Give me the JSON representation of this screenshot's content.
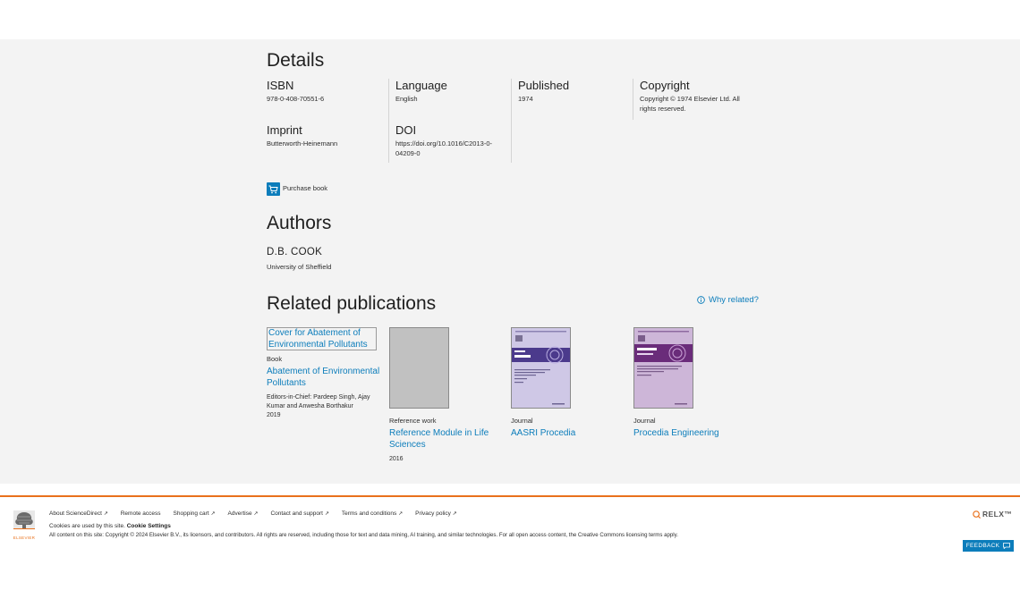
{
  "details": {
    "heading": "Details",
    "isbn_label": "ISBN",
    "isbn_value": "978-0-408-70551-6",
    "language_label": "Language",
    "language_value": "English",
    "published_label": "Published",
    "published_value": "1974",
    "copyright_label": "Copyright",
    "copyright_line1": "Copyright © 1974 Elsevier Ltd. All",
    "copyright_line2": "rights reserved.",
    "imprint_label": "Imprint",
    "imprint_value": "Butterworth-Heinemann",
    "doi_label": "DOI",
    "doi_line1": "https://doi.org/10.1016/C2013-0-",
    "doi_line2": "04209-0",
    "purchase_label": "Purchase book"
  },
  "authors": {
    "heading": "Authors",
    "name": "D.B. COOK",
    "affiliation": "University of Sheffield"
  },
  "related": {
    "heading": "Related publications",
    "why_related": "Why related?",
    "items": [
      {
        "cover_alt_line1": "Cover for Abatement of",
        "cover_alt_line2": "Environmental Pollutants",
        "type": "Book",
        "title_line1": "Abatement of Environmental",
        "title_line2": "Pollutants",
        "editors_line1": "Editors-in-Chief: Pardeep Singh, Ajay",
        "editors_line2": "Kumar and Anwesha Borthakur",
        "year": "2019"
      },
      {
        "type": "Reference work",
        "title_line1": "Reference Module in Life",
        "title_line2": "Sciences",
        "year": "2016"
      },
      {
        "type": "Journal",
        "title": "AASRI Procedia"
      },
      {
        "type": "Journal",
        "title": "Procedia Engineering"
      }
    ]
  },
  "footer": {
    "links": [
      {
        "label": "About ScienceDirect"
      },
      {
        "label": "Remote access"
      },
      {
        "label": "Shopping cart"
      },
      {
        "label": "Advertise"
      },
      {
        "label": "Contact and support"
      },
      {
        "label": "Terms and conditions"
      },
      {
        "label": "Privacy policy"
      }
    ],
    "cookies_text": "Cookies are used by this site.",
    "cookie_settings": "Cookie Settings",
    "copyright_text": "All content on this site: Copyright © 2024 Elsevier B.V., its licensors, and contributors. All rights are reserved, including those for text and data mining, AI training, and similar technologies. For all open access content, the Creative Commons licensing terms apply.",
    "elsevier_wordmark": "ELSEVIER",
    "relx_wordmark": "RELX™",
    "feedback_label": "FEEDBACK"
  },
  "colors": {
    "link": "#0c7dbb",
    "footer_accent": "#e9711c",
    "background": "#f3f3f3"
  }
}
